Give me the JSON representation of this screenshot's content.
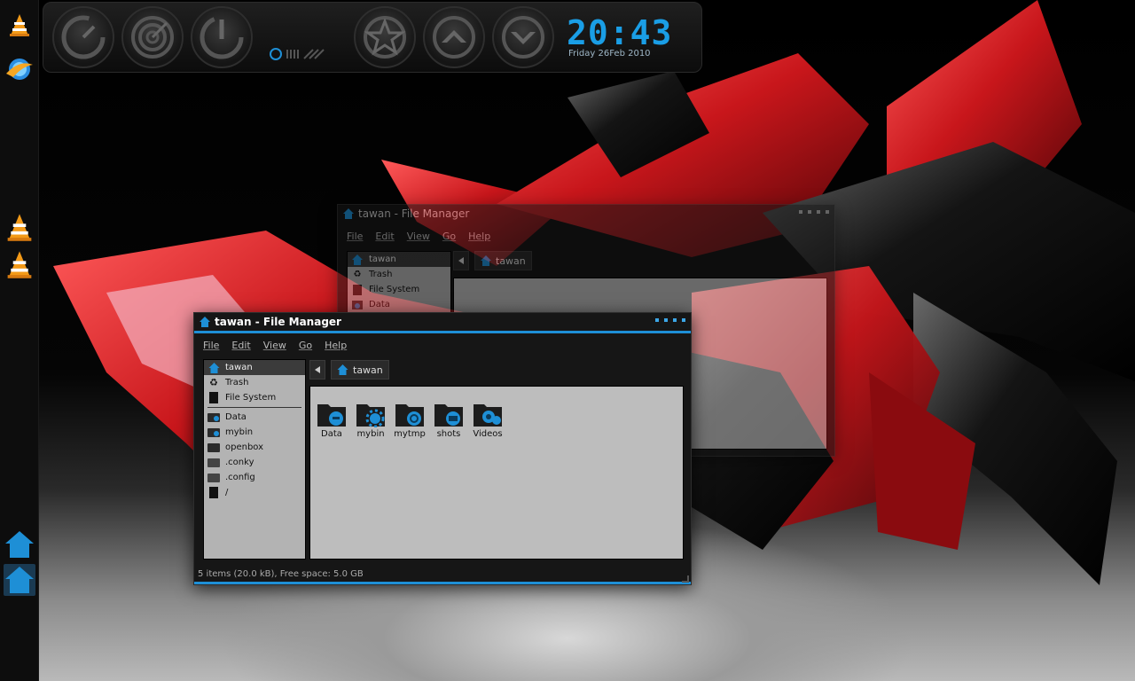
{
  "clock": {
    "time": "20:43",
    "date": "Friday 26Feb 2010"
  },
  "colors": {
    "accent": "#1e8fd6",
    "wallpaper_red": "#c8161b"
  },
  "dock": {
    "items": [
      {
        "icon": "vlc-cone-icon"
      },
      {
        "icon": "browser-globe-icon"
      },
      {
        "icon": "vlc-cone-icon"
      },
      {
        "icon": "vlc-cone-icon"
      },
      {
        "icon": "home-folder-icon"
      },
      {
        "icon": "home-folder-icon",
        "active": true
      }
    ]
  },
  "gadgets": [
    {
      "icon": "gauge-icon"
    },
    {
      "icon": "target-icon"
    },
    {
      "icon": "power-gauge-icon"
    },
    {
      "icon": "star-icon"
    },
    {
      "icon": "chevron-up-icon"
    },
    {
      "icon": "chevron-down-icon"
    }
  ],
  "back_window": {
    "title": "tawan - File Manager",
    "menu": [
      "File",
      "Edit",
      "View",
      "Go",
      "Help"
    ],
    "sidebar": [
      "tawan",
      "Trash",
      "File System",
      "Data"
    ],
    "path": "tawan"
  },
  "front_window": {
    "title": "tawan - File Manager",
    "menu": [
      "File",
      "Edit",
      "View",
      "Go",
      "Help"
    ],
    "sidebar": {
      "places": [
        {
          "label": "tawan",
          "icon": "home-icon",
          "selected": true
        },
        {
          "label": "Trash",
          "icon": "trash-icon"
        },
        {
          "label": "File System",
          "icon": "drive-icon"
        }
      ],
      "bookmarks": [
        {
          "label": "Data",
          "icon": "folder-icon"
        },
        {
          "label": "mybin",
          "icon": "folder-icon"
        },
        {
          "label": "openbox",
          "icon": "folder-icon"
        },
        {
          "label": ".conky",
          "icon": "folder-icon"
        },
        {
          "label": ".config",
          "icon": "folder-icon"
        },
        {
          "label": "/",
          "icon": "drive-icon"
        }
      ]
    },
    "path": "tawan",
    "files": [
      {
        "label": "Data",
        "icon": "folder-data-icon"
      },
      {
        "label": "mybin",
        "icon": "folder-gear-icon"
      },
      {
        "label": "mytmp",
        "icon": "folder-sync-icon"
      },
      {
        "label": "shots",
        "icon": "folder-open-icon"
      },
      {
        "label": "Videos",
        "icon": "folder-film-icon"
      }
    ],
    "status": "5 items (20.0 kB), Free space: 5.0 GB"
  }
}
